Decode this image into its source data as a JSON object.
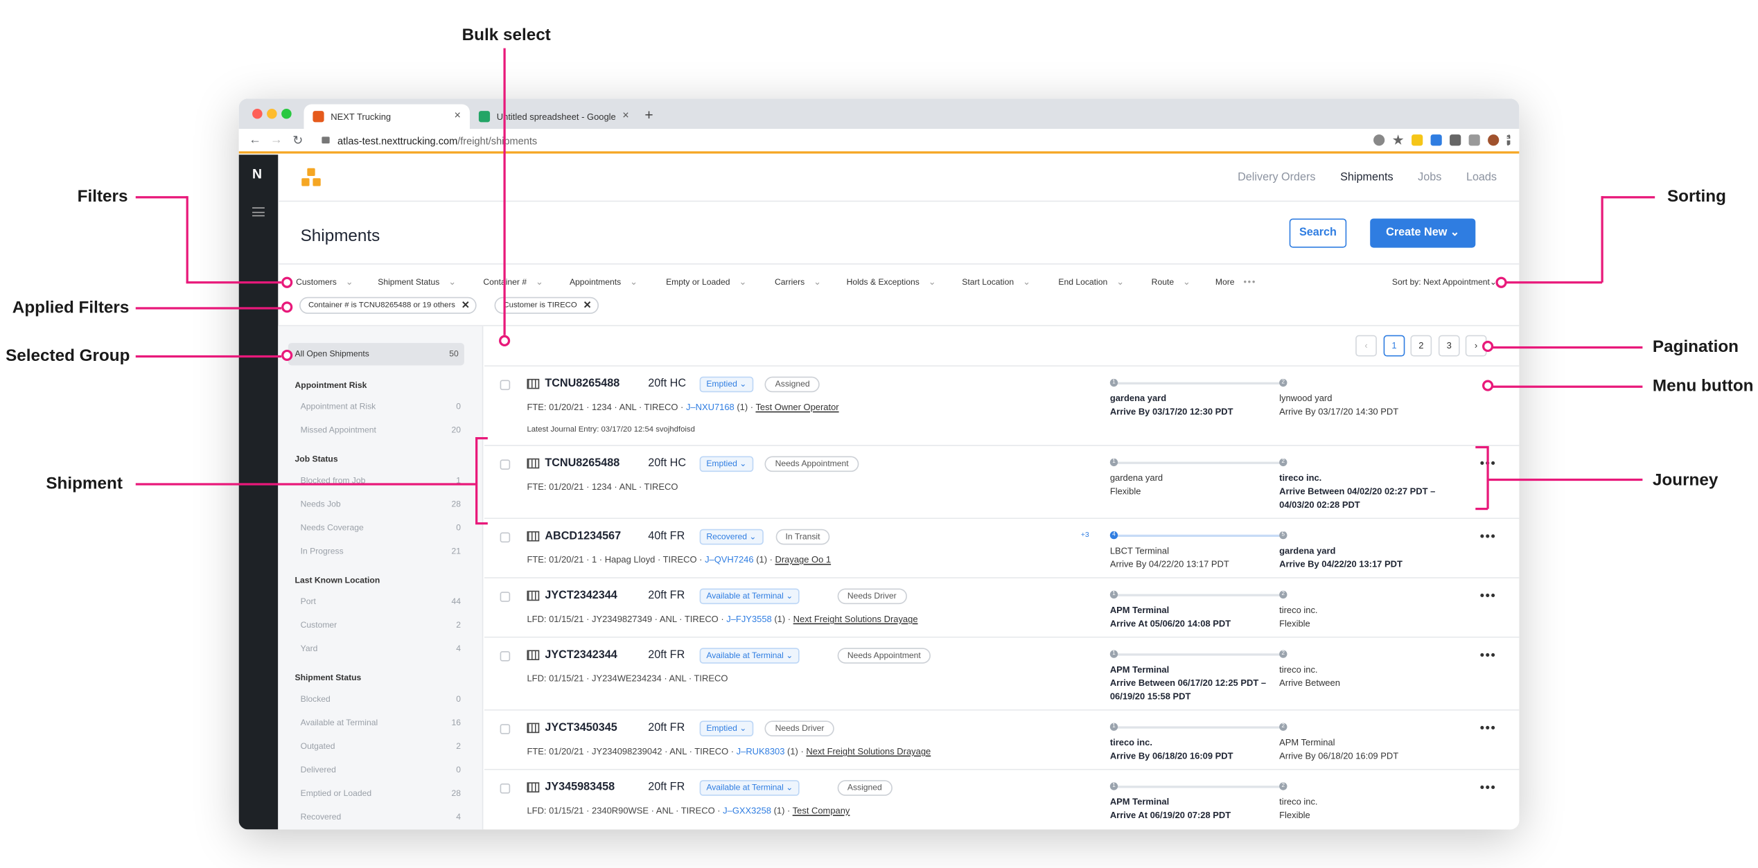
{
  "callouts": {
    "bulk_select": "Bulk select",
    "filters": "Filters",
    "applied_filters": "Applied Filters",
    "selected_group": "Selected Group",
    "shipment": "Shipment",
    "sorting": "Sorting",
    "pagination": "Pagination",
    "menu_button": "Menu button",
    "journey": "Journey"
  },
  "browser": {
    "tabs": [
      {
        "title": "NEXT Trucking",
        "icon": "next-trucking-favicon"
      },
      {
        "title": "Untitled spreadsheet - Google",
        "icon": "google-sheets-favicon"
      }
    ],
    "new_tab": "+",
    "url_host": "atlas-test.nexttrucking.com",
    "url_path": "/freight/shipments",
    "close_glyph": "×"
  },
  "app": {
    "logo": "N",
    "nav": [
      "Delivery Orders",
      "Shipments",
      "Jobs",
      "Loads"
    ],
    "page_title": "Shipments",
    "search_label": "Search",
    "create_label": "Create New ⌄",
    "filters": [
      "Customers",
      "Shipment Status",
      "Container #",
      "Appointments",
      "Empty or Loaded",
      "Carriers",
      "Holds & Exceptions",
      "Start Location",
      "End Location",
      "Route",
      "More"
    ],
    "chevron": "⌄",
    "more_dots": "•••",
    "sort_label": "Sort by: Next Appointment",
    "applied_filters": [
      "Container # is TCNU8265488 or 19 others",
      "Customer is TIRECO"
    ],
    "chip_close": "✕"
  },
  "groups": {
    "selected": {
      "label": "All Open Shipments",
      "count": "50"
    },
    "sections": [
      {
        "title": "Appointment Risk",
        "items": [
          {
            "label": "Appointment at Risk",
            "count": "0"
          },
          {
            "label": "Missed Appointment",
            "count": "20"
          }
        ]
      },
      {
        "title": "Job Status",
        "items": [
          {
            "label": "Blocked from Job",
            "count": "1"
          },
          {
            "label": "Needs Job",
            "count": "28"
          },
          {
            "label": "Needs Coverage",
            "count": "0"
          },
          {
            "label": "In Progress",
            "count": "21"
          }
        ]
      },
      {
        "title": "Last Known Location",
        "items": [
          {
            "label": "Port",
            "count": "44"
          },
          {
            "label": "Customer",
            "count": "2"
          },
          {
            "label": "Yard",
            "count": "4"
          }
        ]
      },
      {
        "title": "Shipment Status",
        "items": [
          {
            "label": "Blocked",
            "count": "0"
          },
          {
            "label": "Available at Terminal",
            "count": "16"
          },
          {
            "label": "Outgated",
            "count": "2"
          },
          {
            "label": "Delivered",
            "count": "0"
          },
          {
            "label": "Emptied or Loaded",
            "count": "28"
          },
          {
            "label": "Recovered",
            "count": "4"
          }
        ]
      }
    ]
  },
  "pagination": {
    "prev": "‹",
    "pages": [
      "1",
      "2",
      "3"
    ],
    "next": "›",
    "current": "1"
  },
  "shipments": [
    {
      "id": "TCNU8265488",
      "size": "20ft HC",
      "status": "Emptied ⌄",
      "tag": "Assigned",
      "meta_a": "FTE: 01/20/21 · 1234 · ANL · TIRECO · ",
      "job": "J–NXU7168",
      "meta_b": " (1) · ",
      "company": "Test Owner Operator",
      "journal": "Latest Journal Entry: 03/17/20 12:54  svojhdfoisd",
      "more": "•••",
      "stop1": {
        "num": "1",
        "name": "gardena yard",
        "detail": "Arrive By 03/17/20 12:30 PDT",
        "detail2": ""
      },
      "stop2": {
        "num": "2",
        "name": "lynwood yard",
        "detail": "Arrive By 03/17/20 14:30 PDT",
        "detail2": ""
      }
    },
    {
      "id": "TCNU8265488",
      "size": "20ft HC",
      "status": "Emptied ⌄",
      "tag": "Needs Appointment",
      "meta_a": "FTE: 01/20/21 · 1234 · ANL · TIRECO",
      "job": "",
      "meta_b": "",
      "company": "",
      "journal": "",
      "more": "•••",
      "stop1": {
        "num": "1",
        "name": "gardena yard",
        "detail": "Flexible",
        "detail2": ""
      },
      "stop2": {
        "num": "2",
        "name": "tireco inc.",
        "detail": "Arrive Between 04/02/20 02:27 PDT –",
        "detail2": "04/03/20 02:28 PDT"
      }
    },
    {
      "id": "ABCD1234567",
      "size": "40ft FR",
      "status": "Recovered ⌄",
      "tag": "In Transit",
      "meta_a": "FTE: 01/20/21 · 1 · Hapag Lloyd · TIRECO · ",
      "job": "J–QVH7246",
      "meta_b": " (1) · ",
      "company": "Drayage Oo 1",
      "journal": "",
      "more": "•••",
      "extra": "+3",
      "stop1": {
        "num": "4",
        "name": "LBCT Terminal",
        "detail": "Arrive By 04/22/20 13:17 PDT",
        "detail2": ""
      },
      "stop2": {
        "num": "5",
        "name": "gardena yard",
        "detail": "Arrive By 04/22/20 13:17 PDT",
        "detail2": ""
      }
    },
    {
      "id": "JYCT2342344",
      "size": "20ft FR",
      "status": "Available at Terminal ⌄",
      "tag": "Needs Driver",
      "meta_a": "LFD: 01/15/21 · JY2349827349 · ANL · TIRECO · ",
      "job": "J–FJY3558",
      "meta_b": " (1) · ",
      "company": "Next Freight Solutions Drayage",
      "journal": "",
      "more": "•••",
      "stop1": {
        "num": "1",
        "name": "APM Terminal",
        "detail": "Arrive At 05/06/20 14:08 PDT",
        "detail2": ""
      },
      "stop2": {
        "num": "2",
        "name": "tireco inc.",
        "detail": "Flexible",
        "detail2": ""
      }
    },
    {
      "id": "JYCT2342344",
      "size": "20ft FR",
      "status": "Available at Terminal ⌄",
      "tag": "Needs Appointment",
      "meta_a": "LFD: 01/15/21 · JY234WE234234 · ANL · TIRECO",
      "job": "",
      "meta_b": "",
      "company": "",
      "journal": "",
      "more": "•••",
      "stop1": {
        "num": "1",
        "name": "APM Terminal",
        "detail": "Arrive Between 06/17/20 12:25 PDT –",
        "detail2": "06/19/20 15:58 PDT"
      },
      "stop2": {
        "num": "2",
        "name": "tireco inc.",
        "detail": "Arrive Between",
        "detail2": ""
      }
    },
    {
      "id": "JYCT3450345",
      "size": "20ft FR",
      "status": "Emptied ⌄",
      "tag": "Needs Driver",
      "meta_a": "FTE: 01/20/21 · JY234098239042 · ANL · TIRECO · ",
      "job": "J–RUK8303",
      "meta_b": " (1) · ",
      "company": "Next Freight Solutions Drayage",
      "journal": "",
      "more": "•••",
      "stop1": {
        "num": "1",
        "name": "tireco inc.",
        "detail": "Arrive By 06/18/20 16:09 PDT",
        "detail2": ""
      },
      "stop2": {
        "num": "2",
        "name": "APM Terminal",
        "detail": "Arrive By 06/18/20 16:09 PDT",
        "detail2": ""
      }
    },
    {
      "id": "JY345983458",
      "size": "20ft FR",
      "status": "Available at Terminal ⌄",
      "tag": "Assigned",
      "meta_a": "LFD: 01/15/21 · 2340R90WSE · ANL · TIRECO · ",
      "job": "J–GXX3258",
      "meta_b": " (1) · ",
      "company": "Test Company",
      "journal": "",
      "more": "•••",
      "stop1": {
        "num": "1",
        "name": "APM Terminal",
        "detail": "Arrive At 06/19/20 07:28 PDT",
        "detail2": ""
      },
      "stop2": {
        "num": "2",
        "name": "tireco inc.",
        "detail": "Flexible",
        "detail2": ""
      }
    }
  ]
}
